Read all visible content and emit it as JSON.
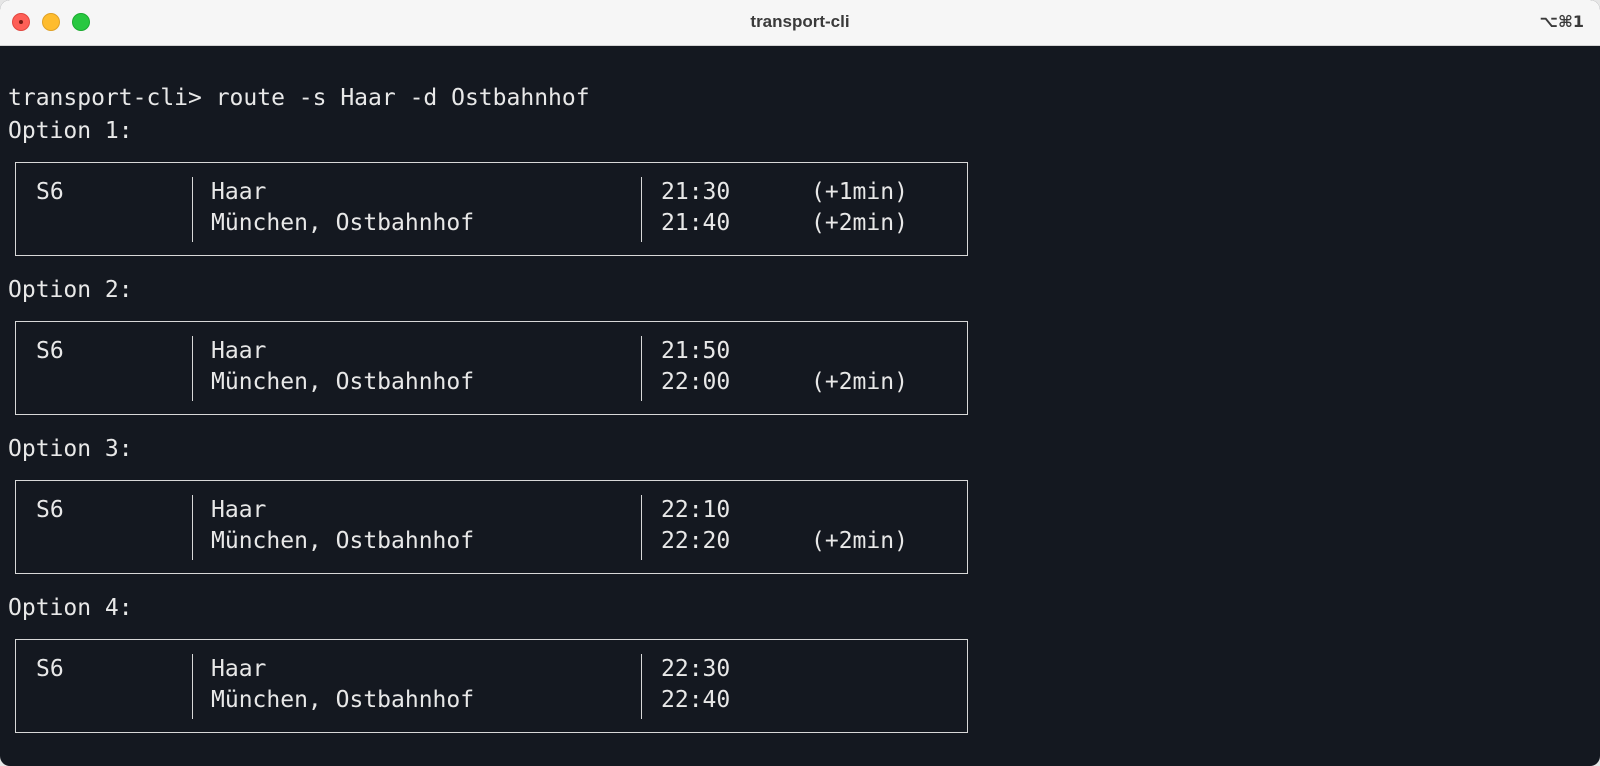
{
  "window": {
    "title": "transport-cli",
    "shortcut": "⌥⌘1"
  },
  "terminal": {
    "prompt": "transport-cli> route -s Haar -d Ostbahnhof",
    "options": [
      {
        "label": "Option 1:",
        "line": "S6",
        "from": "Haar",
        "to": "München, Ostbahnhof",
        "dep_time": "21:30",
        "dep_delay": "(+1min)",
        "arr_time": "21:40",
        "arr_delay": "(+2min)"
      },
      {
        "label": "Option 2:",
        "line": "S6",
        "from": "Haar",
        "to": "München, Ostbahnhof",
        "dep_time": "21:50",
        "dep_delay": "",
        "arr_time": "22:00",
        "arr_delay": "(+2min)"
      },
      {
        "label": "Option 3:",
        "line": "S6",
        "from": "Haar",
        "to": "München, Ostbahnhof",
        "dep_time": "22:10",
        "dep_delay": "",
        "arr_time": "22:20",
        "arr_delay": "(+2min)"
      },
      {
        "label": "Option 4:",
        "line": "S6",
        "from": "Haar",
        "to": "München, Ostbahnhof",
        "dep_time": "22:30",
        "dep_delay": "",
        "arr_time": "22:40",
        "arr_delay": ""
      }
    ]
  }
}
